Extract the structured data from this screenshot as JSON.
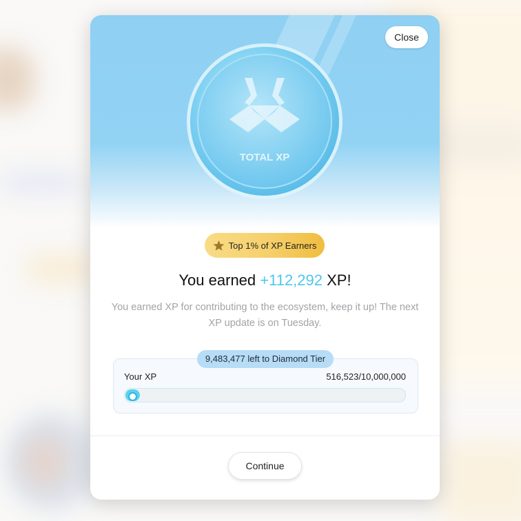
{
  "modal": {
    "close_label": "Close",
    "coin_label": "TOTAL XP",
    "coin_icon": "xp-emblem-icon",
    "badge": {
      "icon": "star-icon",
      "label": "Top 1% of XP Earners"
    },
    "headline": {
      "prefix": "You earned ",
      "amount": "+112,292",
      "suffix": " XP!"
    },
    "subtext": "You earned XP for contributing to the ecosystem, keep it up! The next XP update is on Tuesday.",
    "progress": {
      "remaining_label": "9,483,477 left to Diamond Tier",
      "your_xp_label": "Your XP",
      "fraction_label": "516,523/10,000,000",
      "current": 516523,
      "target": 10000000
    },
    "continue_label": "Continue"
  },
  "colors": {
    "accent": "#4fc6ee",
    "badge_gold": "#f6cf6a",
    "hero_blue": "#8fd0f3"
  }
}
